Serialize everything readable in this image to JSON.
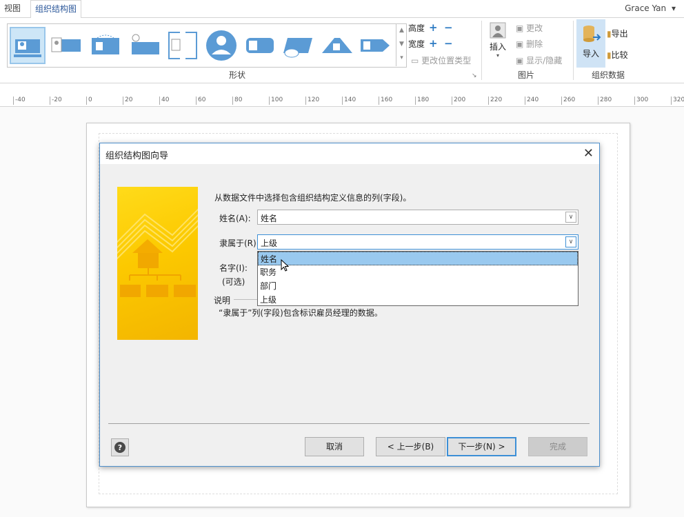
{
  "tabs": [
    {
      "label": "视图"
    },
    {
      "label": "组织结构图"
    }
  ],
  "user": {
    "name": "Grace Yan",
    "caret": "▾"
  },
  "ribbon": {
    "groups": {
      "shapes": "形状",
      "picture": "图片",
      "org_data": "组织数据"
    },
    "height_label": "高度",
    "width_label": "宽度",
    "change_position_type": "更改位置类型",
    "insert_label": "插入",
    "change_label": "更改",
    "delete_label": "删除",
    "show_hide_label": "显示/隐藏",
    "import_label": "导入",
    "export_label": "导出",
    "compare_label": "比较"
  },
  "ruler": {
    "ticks": [
      "-40",
      "-20",
      "0",
      "20",
      "40",
      "60",
      "80",
      "100",
      "120",
      "140",
      "160",
      "180",
      "200",
      "220",
      "240",
      "260",
      "280",
      "300",
      "320"
    ]
  },
  "dialog": {
    "title": "组织结构图向导",
    "intro": "从数据文件中选择包含组织结构定义信息的列(字段)。",
    "name_label": "姓名(A):",
    "name_value": "姓名",
    "reports_label": "隶属于(R):",
    "reports_value": "上级",
    "optional_label_1": "名字(I):",
    "optional_label_2": "(可选)",
    "desc_heading": "说明",
    "desc_text": "“隶属于”列(字段)包含标识雇员经理的数据。",
    "dropdown_options": [
      "姓名",
      "职务",
      "部门",
      "上级"
    ],
    "buttons": {
      "cancel": "取消",
      "back": "< 上一步(B)",
      "next": "下一步(N) >",
      "finish": "完成"
    }
  },
  "colors": {
    "accent": "#2b579a",
    "highlight": "#99c9ef",
    "art": "#fcc900"
  }
}
